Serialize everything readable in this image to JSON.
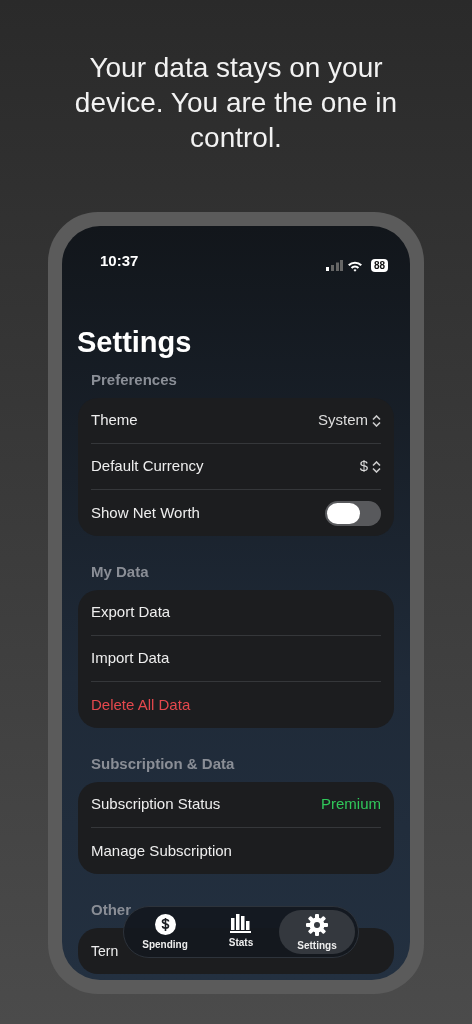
{
  "headline": "Your data stays on your device. You are the one in control.",
  "status_bar": {
    "time": "10:37",
    "battery": "88"
  },
  "title": "Settings",
  "sections": [
    {
      "header": "Preferences",
      "rows": [
        {
          "kind": "picker",
          "label": "Theme",
          "value": "System"
        },
        {
          "kind": "picker",
          "label": "Default Currency",
          "value": "$"
        },
        {
          "kind": "toggle",
          "label": "Show Net Worth",
          "on": false
        }
      ]
    },
    {
      "header": "My Data",
      "rows": [
        {
          "kind": "link",
          "label": "Export Data"
        },
        {
          "kind": "link",
          "label": "Import Data"
        },
        {
          "kind": "destructive",
          "label": "Delete All Data"
        }
      ]
    },
    {
      "header": "Subscription & Data",
      "rows": [
        {
          "kind": "status",
          "label": "Subscription Status",
          "value": "Premium"
        },
        {
          "kind": "link",
          "label": "Manage Subscription"
        }
      ]
    },
    {
      "header": "Other",
      "rows": [
        {
          "kind": "link",
          "label": "Tern"
        }
      ]
    }
  ],
  "tab_bar": [
    {
      "label": "Spending",
      "selected": false
    },
    {
      "label": "Stats",
      "selected": false
    },
    {
      "label": "Settings",
      "selected": true
    }
  ]
}
